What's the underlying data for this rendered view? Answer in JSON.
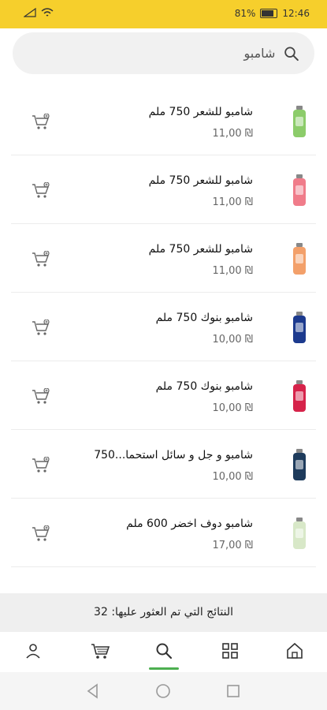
{
  "status": {
    "left_icons": [
      "sim-icon",
      "wifi-icon"
    ],
    "battery": "81%",
    "time": "12:46"
  },
  "search": {
    "value": "شامبو",
    "placeholder": "شامبو"
  },
  "products": [
    {
      "name": "شامبو للشعر  750 ملم",
      "price": "₪ 11,00",
      "thumb_color": "#8ccc6a"
    },
    {
      "name": "شامبو للشعر  750 ملم",
      "price": "₪ 11,00",
      "thumb_color": "#f07c8a"
    },
    {
      "name": "شامبو للشعر  750 ملم",
      "price": "₪ 11,00",
      "thumb_color": "#f3a06a"
    },
    {
      "name": "شامبو بنوك  750 ملم",
      "price": "₪ 10,00",
      "thumb_color": "#1c3a8e"
    },
    {
      "name": "شامبو بنوك  750 ملم",
      "price": "₪ 10,00",
      "thumb_color": "#d6234a"
    },
    {
      "name": "شامبو و جل و سائل استحما...750",
      "price": "₪ 10,00",
      "thumb_color": "#1e3b5c"
    },
    {
      "name": "شامبو دوف  اخضر 600 ملم",
      "price": "₪ 17,00",
      "thumb_color": "#d8e8c8"
    }
  ],
  "results_label": "النتائج التي تم العثور عليها: 32",
  "nav": {
    "items": [
      "profile-icon",
      "cart-icon",
      "search-icon",
      "grid-icon",
      "home-icon"
    ],
    "active": "search-icon"
  },
  "colors": {
    "accent": "#f6cf2c",
    "active_indicator": "#4caf50"
  }
}
